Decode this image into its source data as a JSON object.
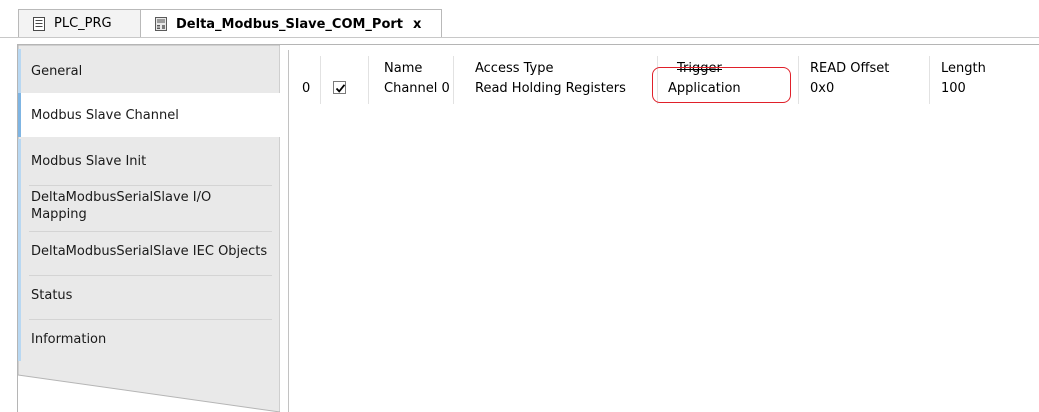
{
  "tabs": {
    "inactive_label": "PLC_PRG",
    "active_label": "Delta_Modbus_Slave_COM_Port",
    "close_glyph": "x"
  },
  "nav": {
    "items": [
      {
        "label": "General"
      },
      {
        "label": "Modbus Slave Channel"
      },
      {
        "label": "Modbus Slave Init"
      },
      {
        "label": "DeltaModbusSerialSlave I/O Mapping"
      },
      {
        "label": "DeltaModbusSerialSlave IEC Objects"
      },
      {
        "label": "Status"
      },
      {
        "label": "Information"
      }
    ],
    "selected": "Modbus Slave Channel"
  },
  "table": {
    "headers": {
      "name": "Name",
      "access_type": "Access Type",
      "trigger": "Trigger",
      "read_offset": "READ Offset",
      "length": "Length"
    },
    "rows": [
      {
        "index": "0",
        "enabled": true,
        "name": "Channel 0",
        "access_type": "Read Holding Registers",
        "trigger": "Application",
        "read_offset": "0x0",
        "length": "100"
      }
    ]
  },
  "colors": {
    "highlight": "#e0202a",
    "nav_accent": "#7fb5e3",
    "nav_background": "#e9e9e9"
  }
}
